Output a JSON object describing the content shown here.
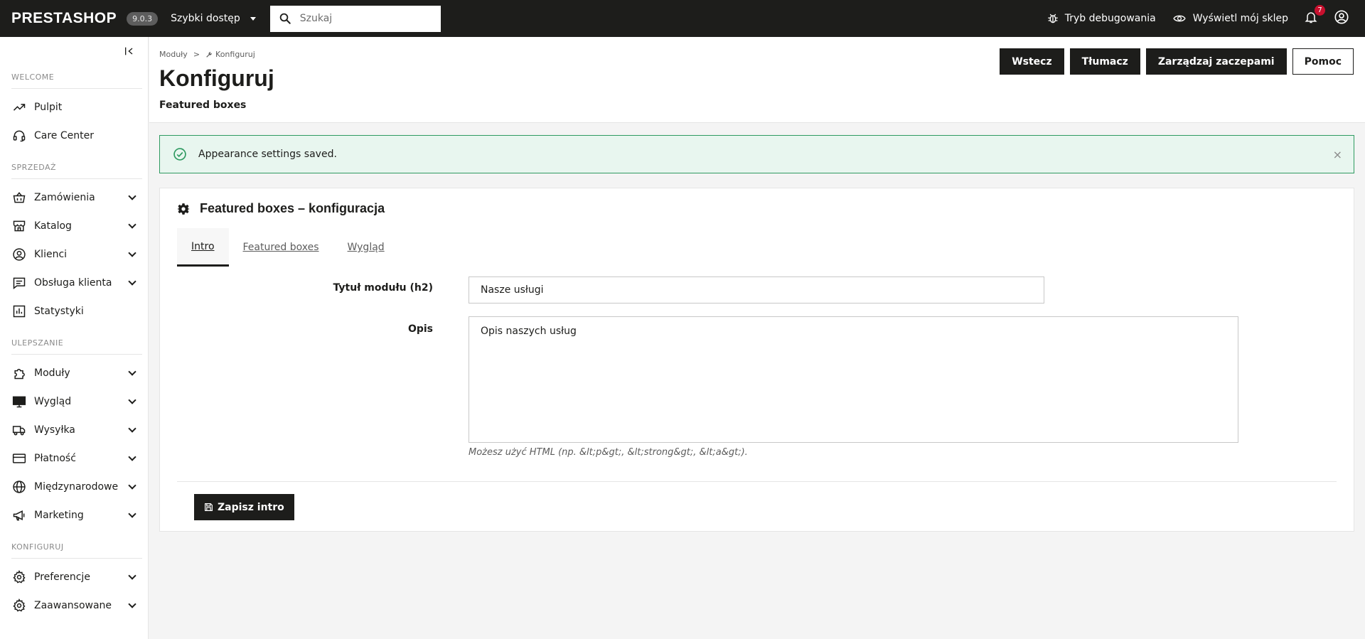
{
  "topbar": {
    "logo": "PRESTASHOP",
    "version": "9.0.3",
    "quick_access": "Szybki dostęp",
    "search_placeholder": "Szukaj",
    "debug": "Tryb debugowania",
    "view_shop": "Wyświetl mój sklep",
    "notifications_count": "7"
  },
  "sidebar": {
    "sections": [
      {
        "title": "WELCOME",
        "items": [
          {
            "label": "Pulpit",
            "icon": "trending-up-icon",
            "expand": false
          },
          {
            "label": "Care Center",
            "icon": "headset-icon",
            "expand": false
          }
        ]
      },
      {
        "title": "SPRZEDAŻ",
        "items": [
          {
            "label": "Zamówienia",
            "icon": "basket-icon",
            "expand": true
          },
          {
            "label": "Katalog",
            "icon": "store-icon",
            "expand": true
          },
          {
            "label": "Klienci",
            "icon": "user-circle-icon",
            "expand": true
          },
          {
            "label": "Obsługa klienta",
            "icon": "chat-icon",
            "expand": true
          },
          {
            "label": "Statystyki",
            "icon": "bar-chart-icon",
            "expand": false
          }
        ]
      },
      {
        "title": "ULEPSZANIE",
        "items": [
          {
            "label": "Moduły",
            "icon": "puzzle-icon",
            "expand": true
          },
          {
            "label": "Wygląd",
            "icon": "monitor-icon",
            "expand": true
          },
          {
            "label": "Wysyłka",
            "icon": "truck-icon",
            "expand": true
          },
          {
            "label": "Płatność",
            "icon": "credit-card-icon",
            "expand": true
          },
          {
            "label": "Międzynarodowe",
            "icon": "globe-icon",
            "expand": true
          },
          {
            "label": "Marketing",
            "icon": "megaphone-icon",
            "expand": true
          }
        ]
      },
      {
        "title": "KONFIGURUJ",
        "items": [
          {
            "label": "Preferencje",
            "icon": "gear-icon",
            "expand": true
          },
          {
            "label": "Zaawansowane",
            "icon": "gear-icon",
            "expand": true
          }
        ]
      }
    ]
  },
  "header": {
    "breadcrumb_parent": "Moduły",
    "breadcrumb_sep": ">",
    "breadcrumb_current": "Konfiguruj",
    "title": "Konfiguruj",
    "subtitle": "Featured boxes",
    "actions": {
      "back": "Wstecz",
      "translate": "Tłumacz",
      "hooks": "Zarządzaj zaczepami",
      "help": "Pomoc"
    }
  },
  "alert": {
    "text": "Appearance settings saved.",
    "close": "×"
  },
  "panel": {
    "title": "Featured boxes – konfiguracja",
    "tabs": [
      {
        "label": "Intro",
        "active": true
      },
      {
        "label": "Featured boxes",
        "active": false
      },
      {
        "label": "Wygląd",
        "active": false
      }
    ],
    "form": {
      "module_title_label": "Tytuł modułu (h2)",
      "module_title_value": "Nasze usługi",
      "description_label": "Opis",
      "description_value": "Opis naszych usług",
      "help": "Możesz użyć HTML (np. &lt;p&gt;, &lt;strong&gt;, &lt;a&gt;)."
    },
    "save_label": "Zapisz intro"
  }
}
